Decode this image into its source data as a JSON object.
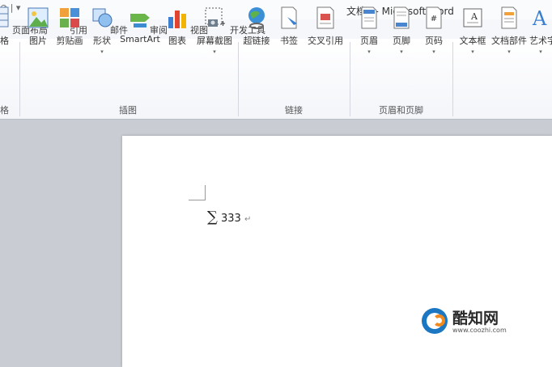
{
  "window": {
    "title": "文档3 - Microsoft Word",
    "qat": "⊘ | ▾"
  },
  "tabs": [
    "页面布局",
    "引用",
    "邮件",
    "审阅",
    "视图",
    "开发工具"
  ],
  "ribbon": {
    "buttons": [
      {
        "label": "格"
      },
      {
        "label": "图片"
      },
      {
        "label": "剪贴画"
      },
      {
        "label": "形状",
        "drop": "▾"
      },
      {
        "label": "SmartArt"
      },
      {
        "label": "图表"
      },
      {
        "label": "屏幕截图",
        "drop": "▾"
      },
      {
        "label": "超链接"
      },
      {
        "label": "书签"
      },
      {
        "label": "交叉引用"
      },
      {
        "label": "页眉",
        "drop": "▾"
      },
      {
        "label": "页脚",
        "drop": "▾"
      },
      {
        "label": "页码",
        "drop": "▾"
      },
      {
        "label": "文本框",
        "drop": "▾"
      },
      {
        "label": "文档部件",
        "drop": "▾"
      },
      {
        "label": "艺术字",
        "drop": "▾"
      }
    ],
    "groups": [
      "格",
      "插图",
      "链接",
      "页眉和页脚"
    ]
  },
  "document": {
    "sigma": "∑",
    "content": "333",
    "para_mark": "↵"
  },
  "watermark": {
    "name": "酷知网",
    "url": "www.coozhi.com"
  },
  "colors": {
    "accent": "#1c77c3",
    "orange": "#f08a1d"
  }
}
